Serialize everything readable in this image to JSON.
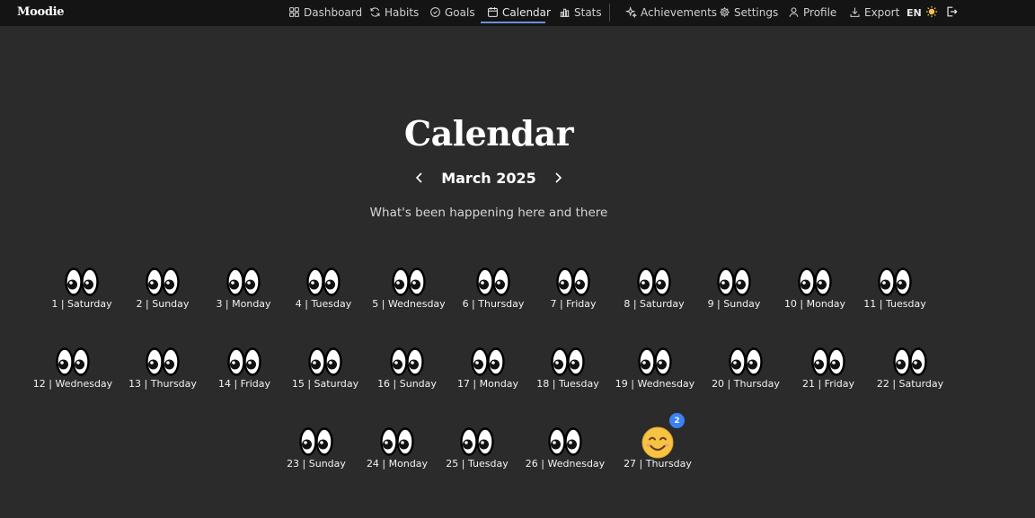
{
  "brand": "Moodie",
  "nav": [
    {
      "label": "Dashboard",
      "icon": "grid-icon"
    },
    {
      "label": "Habits",
      "icon": "refresh-icon"
    },
    {
      "label": "Goals",
      "icon": "check-circle-icon"
    },
    {
      "label": "Calendar",
      "icon": "calendar-icon",
      "active": true
    },
    {
      "label": "Stats",
      "icon": "bar-chart-icon"
    },
    {
      "label": "Achievements",
      "icon": "sparkles-icon"
    },
    {
      "label": "Settings",
      "icon": "gear-icon"
    },
    {
      "label": "Profile",
      "icon": "user-icon"
    },
    {
      "label": "Export",
      "icon": "download-icon"
    }
  ],
  "language": "EN",
  "page": {
    "title": "Calendar",
    "month": "March 2025",
    "subtitle": "What's been happening here and there"
  },
  "colors": {
    "background": "#2b2b2b",
    "topbar": "#141414",
    "accent": "#3b82f6",
    "sun": "#f6c343"
  },
  "days": [
    {
      "label": "1 | Saturday",
      "mood": "eyes"
    },
    {
      "label": "2 | Sunday",
      "mood": "eyes"
    },
    {
      "label": "3 | Monday",
      "mood": "eyes"
    },
    {
      "label": "4 | Tuesday",
      "mood": "eyes"
    },
    {
      "label": "5 | Wednesday",
      "mood": "eyes"
    },
    {
      "label": "6 | Thursday",
      "mood": "eyes"
    },
    {
      "label": "7 | Friday",
      "mood": "eyes"
    },
    {
      "label": "8 | Saturday",
      "mood": "eyes"
    },
    {
      "label": "9 | Sunday",
      "mood": "eyes"
    },
    {
      "label": "10 | Monday",
      "mood": "eyes"
    },
    {
      "label": "11 | Tuesday",
      "mood": "eyes"
    },
    {
      "label": "12 | Wednesday",
      "mood": "eyes"
    },
    {
      "label": "13 | Thursday",
      "mood": "eyes"
    },
    {
      "label": "14 | Friday",
      "mood": "eyes"
    },
    {
      "label": "15 | Saturday",
      "mood": "eyes"
    },
    {
      "label": "16 | Sunday",
      "mood": "eyes"
    },
    {
      "label": "17 | Monday",
      "mood": "eyes"
    },
    {
      "label": "18 | Tuesday",
      "mood": "eyes"
    },
    {
      "label": "19 | Wednesday",
      "mood": "eyes"
    },
    {
      "label": "20 | Thursday",
      "mood": "eyes"
    },
    {
      "label": "21 | Friday",
      "mood": "eyes"
    },
    {
      "label": "22 | Saturday",
      "mood": "eyes"
    },
    {
      "label": "23 | Sunday",
      "mood": "eyes"
    },
    {
      "label": "24 | Monday",
      "mood": "eyes"
    },
    {
      "label": "25 | Tuesday",
      "mood": "eyes"
    },
    {
      "label": "26 | Wednesday",
      "mood": "eyes"
    },
    {
      "label": "27 | Thursday",
      "mood": "smiling-face",
      "badge": "2"
    }
  ]
}
